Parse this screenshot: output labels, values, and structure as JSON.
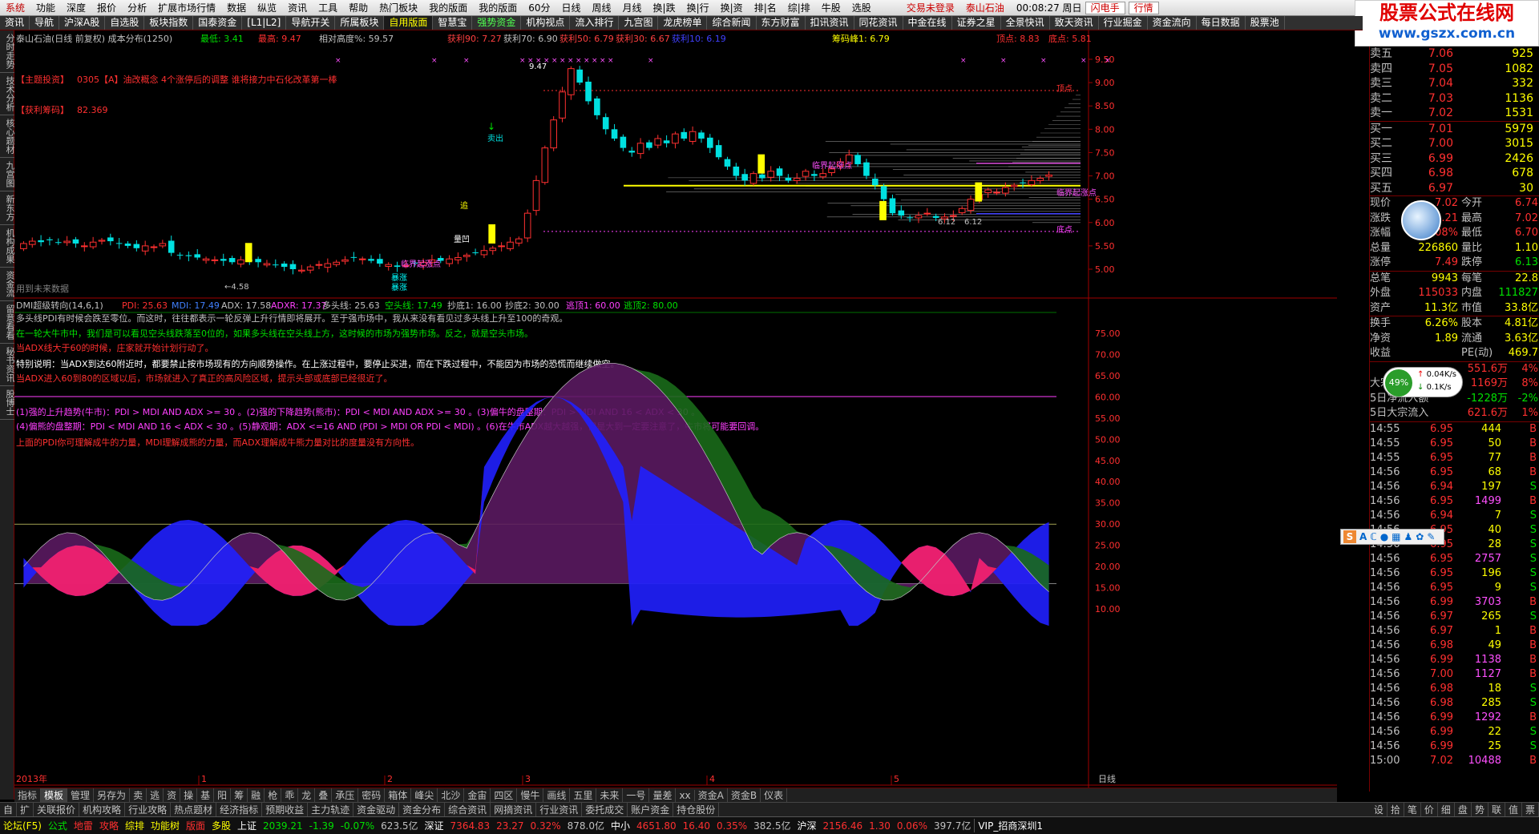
{
  "menu": {
    "items": [
      "系统",
      "功能",
      "深度",
      "报价",
      "分析",
      "扩展市场行情",
      "数据",
      "纵览",
      "资讯",
      "工具",
      "帮助",
      "热门板块",
      "我的版面",
      "我的版面",
      "60分",
      "日线",
      "周线",
      "月线",
      "换|跌",
      "换|行",
      "换|资",
      "排|名",
      "综|排",
      "牛股",
      "选股"
    ],
    "login": "交易未登录",
    "stock": "泰山石油",
    "time": "00:08:27 周日",
    "btn1": "闪电手",
    "btn2": "行情"
  },
  "toolbar": [
    "资讯",
    "导航",
    "沪深A股",
    "自选股",
    "板块指数",
    "国泰资金",
    "[L1|L2]",
    "导航开关",
    "所属板块",
    "自用版面",
    "智慧宝",
    "强势资金",
    "机构视点",
    "流入排行",
    "九宫图",
    "龙虎榜单",
    "综合新闻",
    "东方财富",
    "扣讯资讯",
    "同花资讯",
    "中金在线",
    "证券之星",
    "全景快讯",
    "致天资讯",
    "行业掘金",
    "资金流向",
    "每日数据",
    "股票池"
  ],
  "logo": {
    "line1": "股票公式在线网",
    "line2": "www.gszx.com.cn"
  },
  "left_tabs": [
    "分时走势",
    "技术分析",
    "核心题材",
    "九宫图",
    "新东方",
    "机构成果",
    "资金流",
    "留意看看",
    "秘书资讯",
    "股博士"
  ],
  "chart_header": {
    "name": "泰山石油(日线 前复权) 成本分布(1250)",
    "low_label": "最低: 3.41",
    "high_label": "最高: 9.47",
    "rel_label": "相对高度%: 59.57",
    "profit90": "获利90: 7.27",
    "profit70": "获利70: 6.90",
    "profit50": "获利50: 6.79",
    "profit30": "获利30: 6.67",
    "profit10": "获利10: 6.19",
    "chip_peak": "筹码峰1: 6.79",
    "top_pt": "顶点: 8.83",
    "bot_pt": "底点: 5.81"
  },
  "main_annotations": {
    "theme": "【主题投资】",
    "theme_text": "0305【A】油改概念 4个涨停后的调整 谁将接力中石化改革第一棒",
    "profit_chip": "【获利筹码】",
    "profit_chip_val": "82.369",
    "future": "用到未来数据",
    "sell": "卖出",
    "peak": "9.47",
    "low_price": "4.58",
    "limit1": "临界起涨点",
    "limit2": "临界起涨点",
    "limit3": "临界起涨点",
    "zhang1": "暴涨",
    "zhang2": "暴涨",
    "zhui": "追",
    "liangao": "量凹",
    "top": "顶点",
    "bottom": "底点",
    "p612a": "6.12",
    "p612b": "6.12"
  },
  "price_axis": [
    "9.50",
    "9.00",
    "8.50",
    "8.00",
    "7.50",
    "7.00",
    "6.50",
    "6.00",
    "5.50",
    "5.00"
  ],
  "dmi_header": {
    "name": "DMI超级转向(14,6,1)",
    "pdi": "PDI: 25.63",
    "mdi": "MDI: 17.49",
    "adx": "ADX: 17.58",
    "adxr": "ADXR: 17.37",
    "long": "多头线: 25.63",
    "short": "空头线: 17.49",
    "bot1": "抄底1: 16.00",
    "bot2": "抄底2: 30.00",
    "esc1": "逃顶1: 60.00",
    "esc2": "逃顶2: 80.00"
  },
  "dmi_notes": [
    "多头线PDI有时候会跌至零位。而这时，往往都表示一轮反弹上升行情即将展开。至于强市场中，我从来没有看见过多头线上升至100的奇观。",
    "在一轮大牛市中，我们是可以看见空头线跌落至0位的，如果多头线在空头线上方，这时候的市场为强势市场。反之，就是空头市场。",
    "当ADX线大于60的时候，庄家就开始计划行动了。",
    "特别说明：当ADX到达60附近时，都要禁止按市场现有的方向顺势操作。在上涨过程中，要停止买进，而在下跌过程中，不能因为市场的恐慌而继续做空。",
    "当ADX进入60到80的区域以后，市场就进入了真正的高风险区域，提示头部或底部已经很近了。",
    "(1)强的上升趋势(牛市)：PDI > MDI AND ADX >= 30 。(2)强的下降趋势(熊市)：PDI < MDI AND ADX >= 30 。(3)偏牛的盘整期：PDI > MDI AND 16 < ADX < 30 。",
    "(4)偏熊的盘整期：PDI < MDI AND 16 < ADX < 30 。(5)静观期：ADX <=16 AND (PDI > MDI OR PDI < MDI) 。(6)在牛市ADX越大越强，但是大到一定要注意了，牛市将可能要回调。",
    "上面的PDI你可理解成牛的力量，MDI理解成熊的力量，而ADX理解成牛熊力量对比的度量没有方向性。"
  ],
  "dmi_axis": [
    "75.00",
    "70.00",
    "65.00",
    "60.00",
    "55.00",
    "50.00",
    "45.00",
    "40.00",
    "35.00",
    "30.00",
    "25.00",
    "20.00",
    "15.00",
    "10.00"
  ],
  "x_axis": {
    "year": "2013年",
    "m1": "1",
    "m2": "2",
    "m3": "3",
    "m4": "4",
    "m5": "5",
    "period": "日线"
  },
  "orderbook": {
    "sell": [
      {
        "label": "卖五",
        "price": "7.06",
        "vol": "925"
      },
      {
        "label": "卖四",
        "price": "7.05",
        "vol": "1082"
      },
      {
        "label": "卖三",
        "price": "7.04",
        "vol": "332"
      },
      {
        "label": "卖二",
        "price": "7.03",
        "vol": "1136"
      },
      {
        "label": "卖一",
        "price": "7.02",
        "vol": "1531"
      }
    ],
    "buy": [
      {
        "label": "买一",
        "price": "7.01",
        "vol": "5979"
      },
      {
        "label": "买二",
        "price": "7.00",
        "vol": "3015"
      },
      {
        "label": "买三",
        "price": "6.99",
        "vol": "2426"
      },
      {
        "label": "买四",
        "price": "6.98",
        "vol": "678"
      },
      {
        "label": "买五",
        "price": "6.97",
        "vol": "30"
      }
    ]
  },
  "quote": [
    {
      "k1": "现价",
      "v1": "7.02",
      "k2": "今开",
      "v2": "6.74"
    },
    {
      "k1": "涨跌",
      "v1": "0.21",
      "k2": "最高",
      "v2": "7.02"
    },
    {
      "k1": "涨幅",
      "v1": "3.08%",
      "k2": "最低",
      "v2": "6.70"
    },
    {
      "k1": "总量",
      "v1": "226860",
      "k2": "量比",
      "v2": "1.10"
    },
    {
      "k1": "涨停",
      "v1": "7.49",
      "k2": "跌停",
      "v2": "6.13"
    },
    {
      "k1": "总笔",
      "v1": "9943",
      "k2": "每笔",
      "v2": "22.8"
    },
    {
      "k1": "外盘",
      "v1": "115033",
      "k2": "内盘",
      "v2": "111827"
    },
    {
      "k1": "资产",
      "v1": "11.3亿",
      "k2": "市值",
      "v2": "33.8亿"
    },
    {
      "k1": "换手",
      "v1": "6.26%",
      "k2": "股本",
      "v2": "4.81亿"
    },
    {
      "k1": "净资",
      "v1": "1.89",
      "k2": "流通",
      "v2": "3.63亿"
    },
    {
      "k1": "收益",
      "v1": "",
      "k2": "PE(动)",
      "v2": "469.7"
    }
  ],
  "speed": {
    "pct": "49%",
    "up": "0.04K/s",
    "down": "0.1K/s"
  },
  "flow": [
    {
      "k": "",
      "v": "551.6万",
      "p": "4%"
    },
    {
      "k": "大宗流入",
      "v": "1169万",
      "p": "8%"
    },
    {
      "k": "5日净流入额",
      "v": "-1228万",
      "p": "-2%"
    },
    {
      "k": "5日大宗流入",
      "v": "621.6万",
      "p": "1%"
    }
  ],
  "ticks": [
    {
      "t": "14:55",
      "p": "6.95",
      "v": "444",
      "d": "B"
    },
    {
      "t": "14:55",
      "p": "6.95",
      "v": "50",
      "d": "B"
    },
    {
      "t": "14:55",
      "p": "6.95",
      "v": "77",
      "d": "B"
    },
    {
      "t": "14:56",
      "p": "6.95",
      "v": "68",
      "d": "B"
    },
    {
      "t": "14:56",
      "p": "6.94",
      "v": "197",
      "d": "S"
    },
    {
      "t": "14:56",
      "p": "6.95",
      "v": "1499",
      "d": "B"
    },
    {
      "t": "14:56",
      "p": "6.94",
      "v": "7",
      "d": "S"
    },
    {
      "t": "14:56",
      "p": "6.95",
      "v": "40",
      "d": "S"
    },
    {
      "t": "14:56",
      "p": "6.95",
      "v": "28",
      "d": "S"
    },
    {
      "t": "14:56",
      "p": "6.95",
      "v": "2757",
      "d": "S"
    },
    {
      "t": "14:56",
      "p": "6.95",
      "v": "196",
      "d": "S"
    },
    {
      "t": "14:56",
      "p": "6.95",
      "v": "9",
      "d": "S"
    },
    {
      "t": "14:56",
      "p": "6.99",
      "v": "3703",
      "d": "B"
    },
    {
      "t": "14:56",
      "p": "6.97",
      "v": "265",
      "d": "S"
    },
    {
      "t": "14:56",
      "p": "6.97",
      "v": "1",
      "d": "B"
    },
    {
      "t": "14:56",
      "p": "6.98",
      "v": "49",
      "d": "B"
    },
    {
      "t": "14:56",
      "p": "6.99",
      "v": "1138",
      "d": "B"
    },
    {
      "t": "14:56",
      "p": "7.00",
      "v": "1127",
      "d": "B"
    },
    {
      "t": "14:56",
      "p": "6.98",
      "v": "18",
      "d": "S"
    },
    {
      "t": "14:56",
      "p": "6.98",
      "v": "285",
      "d": "S"
    },
    {
      "t": "14:56",
      "p": "6.99",
      "v": "1292",
      "d": "B"
    },
    {
      "t": "14:56",
      "p": "6.99",
      "v": "22",
      "d": "S"
    },
    {
      "t": "14:56",
      "p": "6.99",
      "v": "25",
      "d": "S"
    },
    {
      "t": "15:00",
      "p": "7.02",
      "v": "10488",
      "d": "B"
    }
  ],
  "bottom_tabs": [
    "指标",
    "模板",
    "管理",
    "另存为",
    "卖",
    "逃",
    "资",
    "操",
    "基",
    "阳",
    "筹",
    "融",
    "枪",
    "乖",
    "龙",
    "叠",
    "承压",
    "密码",
    "箱体",
    "峰尖",
    "北沙",
    "金宙",
    "四区",
    "慢牛",
    "画线",
    "五里",
    "未来",
    "一号",
    "量差",
    "xx",
    "资金A",
    "资金B",
    "仪表"
  ],
  "bottom_tabs2": [
    "自",
    "扩",
    "关联报价",
    "机构攻略",
    "行业攻略",
    "热点题材",
    "经济指标",
    "预期收益",
    "主力轨迹",
    "资金驱动",
    "资金分布",
    "综合资讯",
    "网摘资讯",
    "行业资讯",
    "委托成交",
    "账户资金",
    "持仓股份"
  ],
  "right_tabs": [
    "设",
    "拾",
    "笔",
    "价",
    "细",
    "盘",
    "势",
    "联",
    "值",
    "票"
  ],
  "status": {
    "forum": "论坛(F5)",
    "gongshi": "公式",
    "dilei": "地雷",
    "gonglue": "攻略",
    "zongpai": "综排",
    "gongneng": "功能树",
    "banmian": "版面",
    "duoban": "多股",
    "sh_label": "上证",
    "sh": "2039.21",
    "sh_chg": "-1.39",
    "sh_pct": "-0.07%",
    "sh_amt": "623.5亿",
    "sz_label": "深证",
    "sz": "7364.83",
    "sz_chg": "23.27",
    "sz_pct": "0.32%",
    "sz_amt": "878.0亿",
    "zx_label": "中小",
    "zx": "4651.80",
    "zx_chg": "16.40",
    "zx_pct": "0.35%",
    "zx_amt": "382.5亿",
    "hs_label": "沪深",
    "hs": "2156.46",
    "hs_chg": "1.30",
    "hs_pct": "0.06%",
    "hs_amt": "397.7亿",
    "vip": "VIP_招商深圳1"
  },
  "colors": {
    "up": "#ff3030",
    "down": "#00e0e0",
    "pdi_fill": "#ff2060",
    "mdi_fill": "#2020ff",
    "adx_fill": "#5a1a60",
    "adxr_fill": "#1a6a1a"
  }
}
